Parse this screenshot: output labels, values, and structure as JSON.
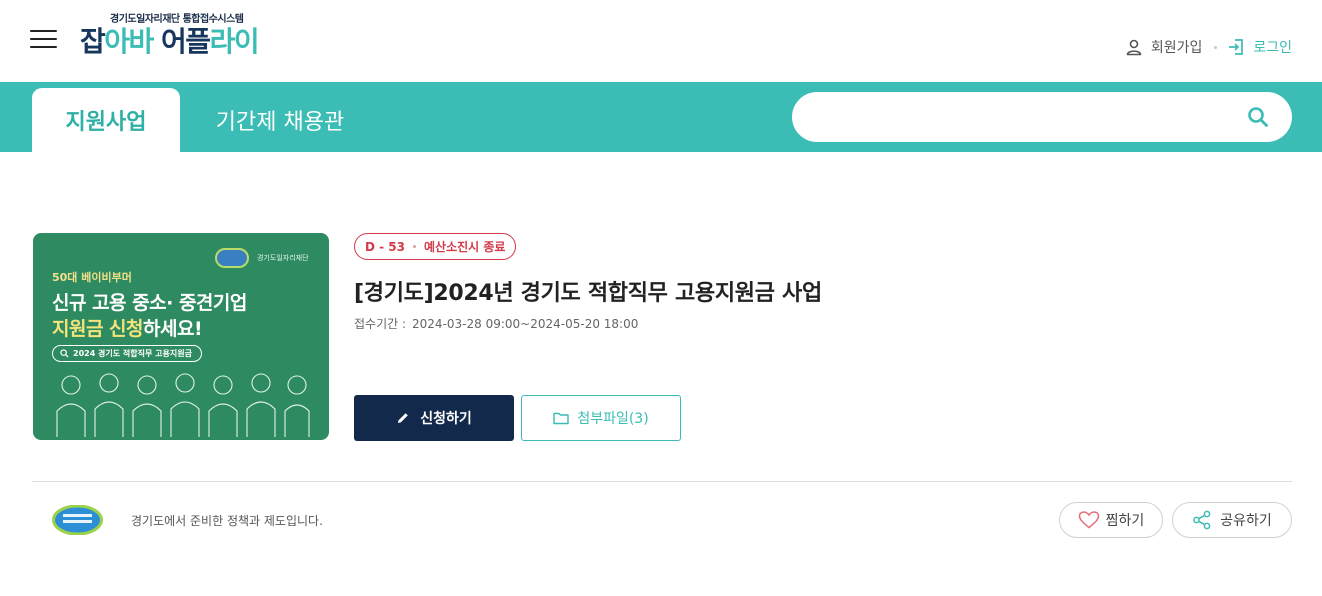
{
  "header": {
    "logo_sub": "경기도일자리재단 통합접수시스템",
    "logo_parts": [
      "잡",
      "아바 ",
      "어플",
      "라이"
    ],
    "join_label": "회원가입",
    "login_label": "로그인"
  },
  "nav": {
    "tabs": [
      {
        "label": "지원사업",
        "active": true
      },
      {
        "label": "기간제 채용관",
        "active": false
      }
    ],
    "search": {
      "placeholder": "",
      "value": ""
    }
  },
  "program": {
    "thumbnail": {
      "badge_text": "경기도일자리재단",
      "line1": "50대 베이비부머",
      "line2": "신규 고용 중소· 중견기업",
      "line3_highlight": "지원금 신청",
      "line3_rest": "하세요!",
      "pill": "2024 경기도 적합직무 고용지원금"
    },
    "dday": "D - 53",
    "status": "예산소진시 종료",
    "title": "[경기도]2024년 경기도 적합직무 고용지원금 사업",
    "period_label": "접수기간 :",
    "period_value": "2024-03-28 09:00~2024-05-20 18:00",
    "apply_label": "신청하기",
    "attach_label": "첨부파일(3)"
  },
  "footer": {
    "org_text": "경기도에서 준비한 정책과 제도입니다.",
    "like_label": "찜하기",
    "share_label": "공유하기"
  },
  "colors": {
    "teal": "#3bbcb4",
    "navy": "#13294b",
    "dday_red": "#d33a4a",
    "thumb_green": "#2e8b61"
  },
  "icons": {
    "menu": "hamburger-icon",
    "join": "person-icon",
    "login": "login-icon",
    "search": "search-icon",
    "apply": "pencil-icon",
    "attach": "folder-icon",
    "like": "heart-icon",
    "share": "share-icon"
  }
}
